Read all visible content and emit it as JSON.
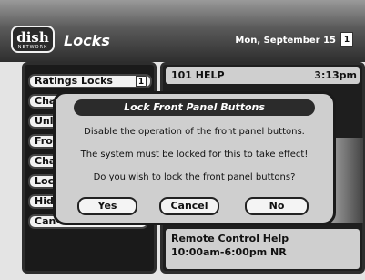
{
  "header": {
    "logo_text": "dish",
    "logo_sub": "NETWORK",
    "title": "Locks",
    "date": "Mon, September 15",
    "calendar_day": "1"
  },
  "menu": {
    "items": [
      {
        "label": "Ratings Locks",
        "badge": "1"
      },
      {
        "label": "Cha"
      },
      {
        "label": "Unl"
      },
      {
        "label": "Fro"
      },
      {
        "label": "Cha"
      },
      {
        "label": "Loc"
      },
      {
        "label": "Hid"
      },
      {
        "label": "Can"
      }
    ]
  },
  "info": {
    "channel": "101 HELP",
    "time": "3:13pm",
    "program_title": "Remote Control Help",
    "program_time": "10:00am-6:00pm NR"
  },
  "dialog": {
    "title": "Lock Front Panel Buttons",
    "line1": "Disable the operation of the front panel buttons.",
    "line2": "The system must be locked for this to take effect!",
    "line3": "Do you wish to lock the front panel buttons?",
    "yes_label": "Yes",
    "cancel_label": "Cancel",
    "no_label": "No"
  }
}
